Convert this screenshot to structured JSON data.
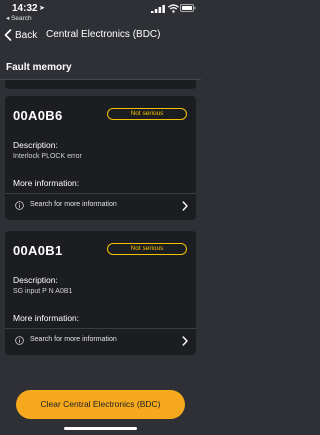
{
  "status_bar": {
    "time": "14:32",
    "back_app": "◂ Search"
  },
  "nav": {
    "back_label": "Back",
    "title": "Central Electronics (BDC)"
  },
  "section": {
    "title": "Fault memory"
  },
  "faults": [
    {
      "code": "00A0B6",
      "severity": "Not serious",
      "description_label": "Description:",
      "description": "Interlock PLOCK error",
      "more_label": "More information:",
      "search_label": "Search for more information"
    },
    {
      "code": "00A0B1",
      "severity": "Not serious",
      "description_label": "Description:",
      "description": "SG input P N A0B1",
      "more_label": "More information:",
      "search_label": "Search for more information"
    }
  ],
  "actions": {
    "clear_label": "Clear Central Electronics (BDC)"
  },
  "colors": {
    "background": "#2e3036",
    "card": "#1c1d21",
    "accent": "#f6a91d",
    "badge": "#f2c200"
  },
  "icons": {
    "location": "location-arrow-icon",
    "signal": "cellular-signal-icon",
    "wifi": "wifi-icon",
    "battery": "battery-icon",
    "back": "chevron-left-icon",
    "info": "info-circle-icon",
    "forward": "chevron-right-icon"
  }
}
